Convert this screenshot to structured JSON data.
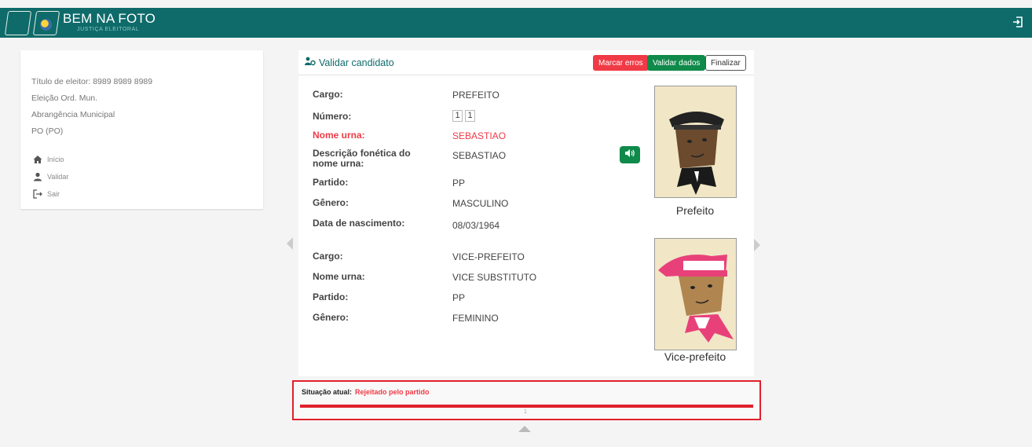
{
  "header": {
    "app_title": "BEM NA FOTO",
    "app_subtitle": "JUSTIÇA ELEITORAL",
    "logout_icon": "logout-icon"
  },
  "sidebar": {
    "info": [
      "Título de eleitor: 8989 8989 8989",
      "Eleição Ord. Mun.",
      "Abrangência Municipal",
      "PO (PO)"
    ],
    "nav": [
      {
        "label": "Início",
        "icon": "home-icon"
      },
      {
        "label": "Validar",
        "icon": "user-icon"
      },
      {
        "label": "Sair",
        "icon": "logout-icon"
      }
    ]
  },
  "card": {
    "title": "Validar candidato",
    "buttons": {
      "mark_errors": "Marcar erros",
      "validate": "Validar dados",
      "finish": "Finalizar"
    },
    "prefeito": {
      "cargo_label": "Cargo:",
      "cargo": "PREFEITO",
      "numero_label": "Número:",
      "numero_digits": [
        "1",
        "1"
      ],
      "nome_label": "Nome urna:",
      "nome": "SEBASTIAO",
      "fonetica_label": "Descrição fonética do nome urna:",
      "fonetica": "SEBASTIAO",
      "partido_label": "Partido:",
      "partido": "PP",
      "genero_label": "Gênero:",
      "genero": "MASCULINO",
      "nascimento_label": "Data de nascimento:",
      "nascimento": "08/03/1964",
      "photo_caption": "Prefeito"
    },
    "vice": {
      "cargo_label": "Cargo:",
      "cargo": "VICE-PREFEITO",
      "nome_label": "Nome urna:",
      "nome": "VICE SUBSTITUTO",
      "partido_label": "Partido:",
      "partido": "PP",
      "genero_label": "Gênero:",
      "genero": "FEMININO",
      "photo_caption": "Vice-prefeito"
    }
  },
  "status": {
    "label": "Situação atual:",
    "value": "Rejeitado pelo partido",
    "page": "1"
  },
  "colors": {
    "brand": "#0e6b6a",
    "error": "#f03a46",
    "success": "#0f8a4a"
  }
}
